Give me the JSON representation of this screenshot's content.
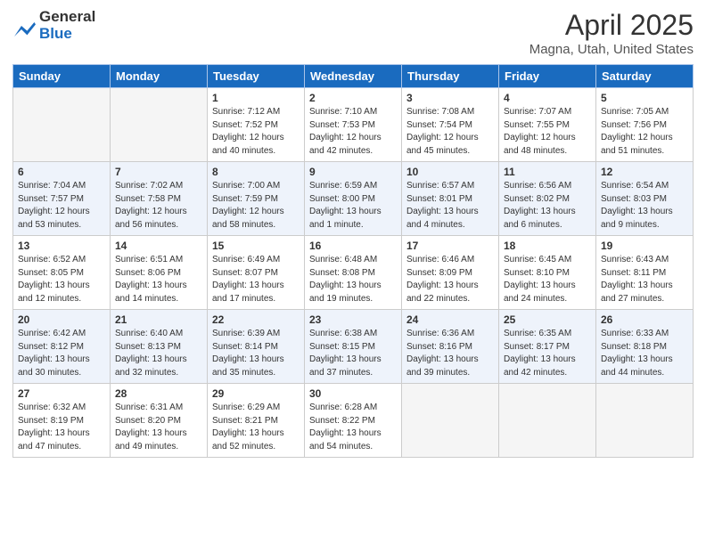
{
  "logo": {
    "general": "General",
    "blue": "Blue"
  },
  "title": "April 2025",
  "location": "Magna, Utah, United States",
  "days_of_week": [
    "Sunday",
    "Monday",
    "Tuesday",
    "Wednesday",
    "Thursday",
    "Friday",
    "Saturday"
  ],
  "weeks": [
    [
      {
        "day": "",
        "info": ""
      },
      {
        "day": "",
        "info": ""
      },
      {
        "day": "1",
        "info": "Sunrise: 7:12 AM\nSunset: 7:52 PM\nDaylight: 12 hours and 40 minutes."
      },
      {
        "day": "2",
        "info": "Sunrise: 7:10 AM\nSunset: 7:53 PM\nDaylight: 12 hours and 42 minutes."
      },
      {
        "day": "3",
        "info": "Sunrise: 7:08 AM\nSunset: 7:54 PM\nDaylight: 12 hours and 45 minutes."
      },
      {
        "day": "4",
        "info": "Sunrise: 7:07 AM\nSunset: 7:55 PM\nDaylight: 12 hours and 48 minutes."
      },
      {
        "day": "5",
        "info": "Sunrise: 7:05 AM\nSunset: 7:56 PM\nDaylight: 12 hours and 51 minutes."
      }
    ],
    [
      {
        "day": "6",
        "info": "Sunrise: 7:04 AM\nSunset: 7:57 PM\nDaylight: 12 hours and 53 minutes."
      },
      {
        "day": "7",
        "info": "Sunrise: 7:02 AM\nSunset: 7:58 PM\nDaylight: 12 hours and 56 minutes."
      },
      {
        "day": "8",
        "info": "Sunrise: 7:00 AM\nSunset: 7:59 PM\nDaylight: 12 hours and 58 minutes."
      },
      {
        "day": "9",
        "info": "Sunrise: 6:59 AM\nSunset: 8:00 PM\nDaylight: 13 hours and 1 minute."
      },
      {
        "day": "10",
        "info": "Sunrise: 6:57 AM\nSunset: 8:01 PM\nDaylight: 13 hours and 4 minutes."
      },
      {
        "day": "11",
        "info": "Sunrise: 6:56 AM\nSunset: 8:02 PM\nDaylight: 13 hours and 6 minutes."
      },
      {
        "day": "12",
        "info": "Sunrise: 6:54 AM\nSunset: 8:03 PM\nDaylight: 13 hours and 9 minutes."
      }
    ],
    [
      {
        "day": "13",
        "info": "Sunrise: 6:52 AM\nSunset: 8:05 PM\nDaylight: 13 hours and 12 minutes."
      },
      {
        "day": "14",
        "info": "Sunrise: 6:51 AM\nSunset: 8:06 PM\nDaylight: 13 hours and 14 minutes."
      },
      {
        "day": "15",
        "info": "Sunrise: 6:49 AM\nSunset: 8:07 PM\nDaylight: 13 hours and 17 minutes."
      },
      {
        "day": "16",
        "info": "Sunrise: 6:48 AM\nSunset: 8:08 PM\nDaylight: 13 hours and 19 minutes."
      },
      {
        "day": "17",
        "info": "Sunrise: 6:46 AM\nSunset: 8:09 PM\nDaylight: 13 hours and 22 minutes."
      },
      {
        "day": "18",
        "info": "Sunrise: 6:45 AM\nSunset: 8:10 PM\nDaylight: 13 hours and 24 minutes."
      },
      {
        "day": "19",
        "info": "Sunrise: 6:43 AM\nSunset: 8:11 PM\nDaylight: 13 hours and 27 minutes."
      }
    ],
    [
      {
        "day": "20",
        "info": "Sunrise: 6:42 AM\nSunset: 8:12 PM\nDaylight: 13 hours and 30 minutes."
      },
      {
        "day": "21",
        "info": "Sunrise: 6:40 AM\nSunset: 8:13 PM\nDaylight: 13 hours and 32 minutes."
      },
      {
        "day": "22",
        "info": "Sunrise: 6:39 AM\nSunset: 8:14 PM\nDaylight: 13 hours and 35 minutes."
      },
      {
        "day": "23",
        "info": "Sunrise: 6:38 AM\nSunset: 8:15 PM\nDaylight: 13 hours and 37 minutes."
      },
      {
        "day": "24",
        "info": "Sunrise: 6:36 AM\nSunset: 8:16 PM\nDaylight: 13 hours and 39 minutes."
      },
      {
        "day": "25",
        "info": "Sunrise: 6:35 AM\nSunset: 8:17 PM\nDaylight: 13 hours and 42 minutes."
      },
      {
        "day": "26",
        "info": "Sunrise: 6:33 AM\nSunset: 8:18 PM\nDaylight: 13 hours and 44 minutes."
      }
    ],
    [
      {
        "day": "27",
        "info": "Sunrise: 6:32 AM\nSunset: 8:19 PM\nDaylight: 13 hours and 47 minutes."
      },
      {
        "day": "28",
        "info": "Sunrise: 6:31 AM\nSunset: 8:20 PM\nDaylight: 13 hours and 49 minutes."
      },
      {
        "day": "29",
        "info": "Sunrise: 6:29 AM\nSunset: 8:21 PM\nDaylight: 13 hours and 52 minutes."
      },
      {
        "day": "30",
        "info": "Sunrise: 6:28 AM\nSunset: 8:22 PM\nDaylight: 13 hours and 54 minutes."
      },
      {
        "day": "",
        "info": ""
      },
      {
        "day": "",
        "info": ""
      },
      {
        "day": "",
        "info": ""
      }
    ]
  ]
}
